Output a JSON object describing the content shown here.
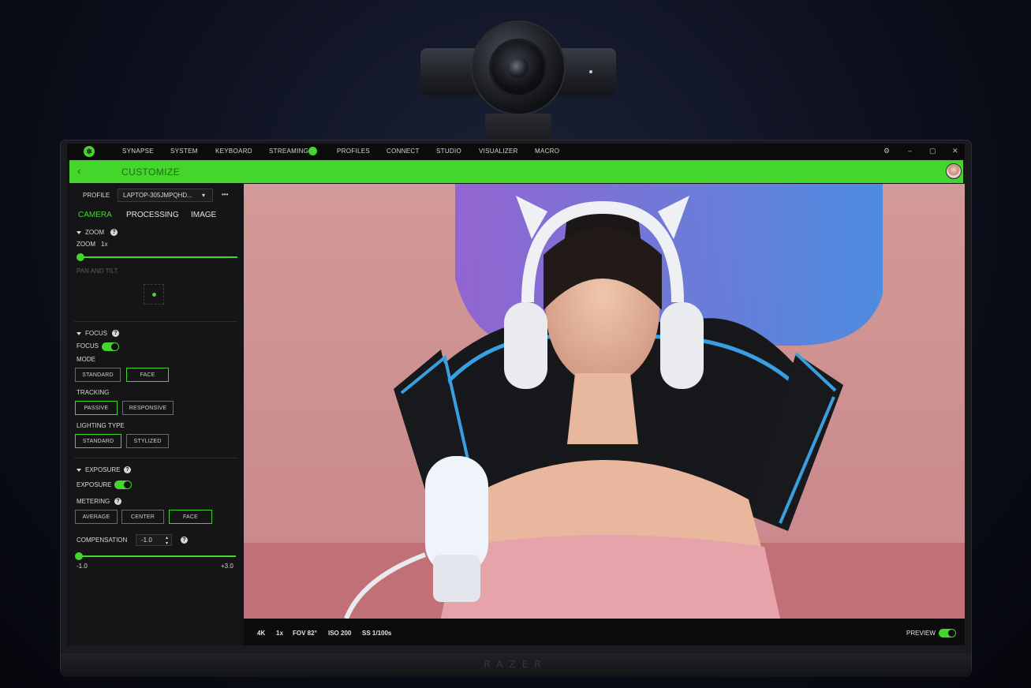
{
  "topnav": {
    "logo_icon": "razer-logo-icon",
    "items": [
      "SYNAPSE",
      "SYSTEM",
      "KEYBOARD",
      "STREAMING",
      "PROFILES",
      "CONNECT",
      "STUDIO",
      "VISUALIZER",
      "MACRO"
    ],
    "window_controls": {
      "settings": "⚙",
      "minimize": "–",
      "maximize": "▢",
      "close": "✕"
    }
  },
  "header": {
    "back_icon": "chevron-left-icon",
    "title": "CUSTOMIZE"
  },
  "panel": {
    "profile_label": "PROFILE",
    "profile_value": "LAPTOP-305JMPQHD...",
    "more": "•••",
    "tabs": [
      "CAMERA",
      "PROCESSING",
      "IMAGE"
    ],
    "zoom": {
      "section": "ZOOM",
      "label": "ZOOM",
      "value": "1x",
      "pan_label": "PAN AND TILT"
    },
    "focus": {
      "section": "FOCUS",
      "toggle_label": "FOCUS",
      "toggle_on": true,
      "mode_label": "MODE",
      "mode_options": [
        "STANDARD",
        "FACE"
      ],
      "mode_selected": "FACE",
      "tracking_label": "TRACKING",
      "tracking_options": [
        "PASSIVE",
        "RESPONSIVE"
      ],
      "tracking_selected": "PASSIVE",
      "lighting_label": "LIGHTING TYPE",
      "lighting_options": [
        "STANDARD",
        "STYLIZED"
      ],
      "lighting_selected": "STANDARD"
    },
    "exposure": {
      "section": "EXPOSURE",
      "toggle_label": "EXPOSURE",
      "toggle_on": true,
      "metering_label": "METERING",
      "metering_options": [
        "AVERAGE",
        "CENTER",
        "FACE"
      ],
      "metering_selected": "FACE",
      "compensation_label": "COMPENSATION",
      "compensation_value": "-1.0",
      "range_min": "-1.0",
      "range_max": "+3.0"
    }
  },
  "bottombar": {
    "stats": [
      "4K",
      "1x",
      "FOV 82°",
      "ISO 200",
      "SS 1/100s"
    ],
    "preview_label": "PREVIEW",
    "preview_on": true
  },
  "brand": "RAZER",
  "colors": {
    "accent": "#44d62c",
    "panel": "#151517",
    "background": "#0c0f1c"
  }
}
